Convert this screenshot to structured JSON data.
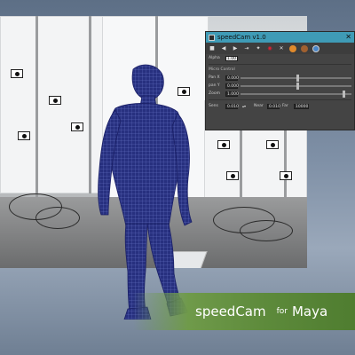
{
  "window": {
    "title": "speedCam v1.0",
    "close_glyph": "✕",
    "toolbar": [
      "camera-icon",
      "prev-icon",
      "next-icon",
      "export-icon",
      "magic-icon",
      "record-icon",
      "clear-icon",
      "orange-ball-icon",
      "brown-ball-icon",
      "globe-icon"
    ],
    "alpha": {
      "label": "Alpha",
      "value": "1.00"
    },
    "section_title": "Micro Control",
    "pan_x": {
      "label": "Pan X",
      "value": "0.000",
      "level": 0.5
    },
    "pan_y": {
      "label": "pan Y",
      "value": "0.000",
      "level": 0.5
    },
    "zoom": {
      "label": "Zoom",
      "value": "1.000",
      "level": 0.92
    },
    "sens": {
      "label": "Sens",
      "value": "0.010"
    },
    "near": {
      "label": "Near",
      "value": "0.010"
    },
    "far": {
      "label": "Far",
      "value": "10000"
    }
  },
  "banner": {
    "product": "speedCam",
    "for": "for",
    "host": "Maya"
  },
  "colors": {
    "titlebar": "#3f9bb6",
    "mesh": "#1e237e",
    "banner": "#5d8a3b"
  }
}
